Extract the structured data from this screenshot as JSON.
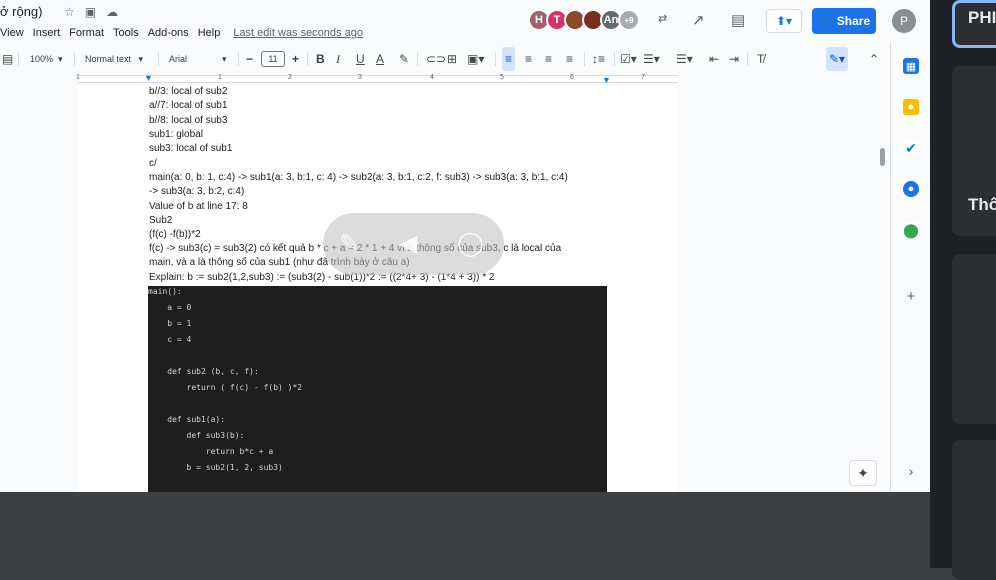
{
  "doc": {
    "title_fragment": "ở rộng)",
    "last_edit": "Last edit was seconds ago"
  },
  "menu": [
    "View",
    "Insert",
    "Format",
    "Tools",
    "Add-ons",
    "Help"
  ],
  "collaborators": [
    {
      "initial": "H",
      "color": "#a0616e"
    },
    {
      "initial": "T",
      "color": "#d6336c"
    },
    {
      "initial": "",
      "color": "#8d4a2b"
    },
    {
      "initial": "",
      "color": "#7a2e22"
    },
    {
      "initial": "An",
      "color": "#5f6b6d"
    },
    {
      "initial": "+9",
      "color": "#a8abaf"
    }
  ],
  "share_label": "Share",
  "profile_initial": "P",
  "toolbar": {
    "zoom": "100%",
    "style": "Normal text",
    "font": "Arial",
    "font_size": "11"
  },
  "ruler_numbers": [
    "1",
    "1",
    "2",
    "3",
    "4",
    "5",
    "6",
    "7"
  ],
  "doc_lines": [
    "b//3: local of sub2",
    "a//7: local of sub1",
    "b//8: local of sub3",
    "sub1: global",
    "sub3: local of sub1",
    "c/",
    "main(a: 0, b: 1, c:4) -> sub1(a: 3, b:1, c: 4) -> sub2(a: 3, b:1, c:2, f: sub3) -> sub3(a: 3, b:1, c:4)",
    "-> sub3(a: 3, b:2, c:4)",
    "Value of b at line 17: 8",
    "Sub2",
    "(f(c) -f(b))*2",
    "f(c) -> sub3(c) = sub3(2) có kết quả b * c + a = 2 * 1 + 4 vì b thông số của sub3, c là local của",
    "main, và a là thông số của sub1 (như đã trình bày ở câu a)",
    "Explain: b := sub2(1,2,sub3) := (sub3(2) - sub(1))*2 := ((2*4+ 3) - (1*4 + 3)) * 2"
  ],
  "code_lines": [
    "main():",
    "    a = 0",
    "    b = 1",
    "    c = 4",
    "",
    "    def sub2 (b, c, f):",
    "        return ( f(c) - f(b) )*2",
    "",
    "    def sub1(a):",
    "        def sub3(b):",
    "            return b*c + a",
    "        b = sub2(1, 2, sub3)"
  ],
  "right_panel": {
    "label_top": "PHI",
    "label_mid": "Thô"
  },
  "colors": {
    "accent": "#1a73e8",
    "code_bg": "#1e1e1e"
  }
}
